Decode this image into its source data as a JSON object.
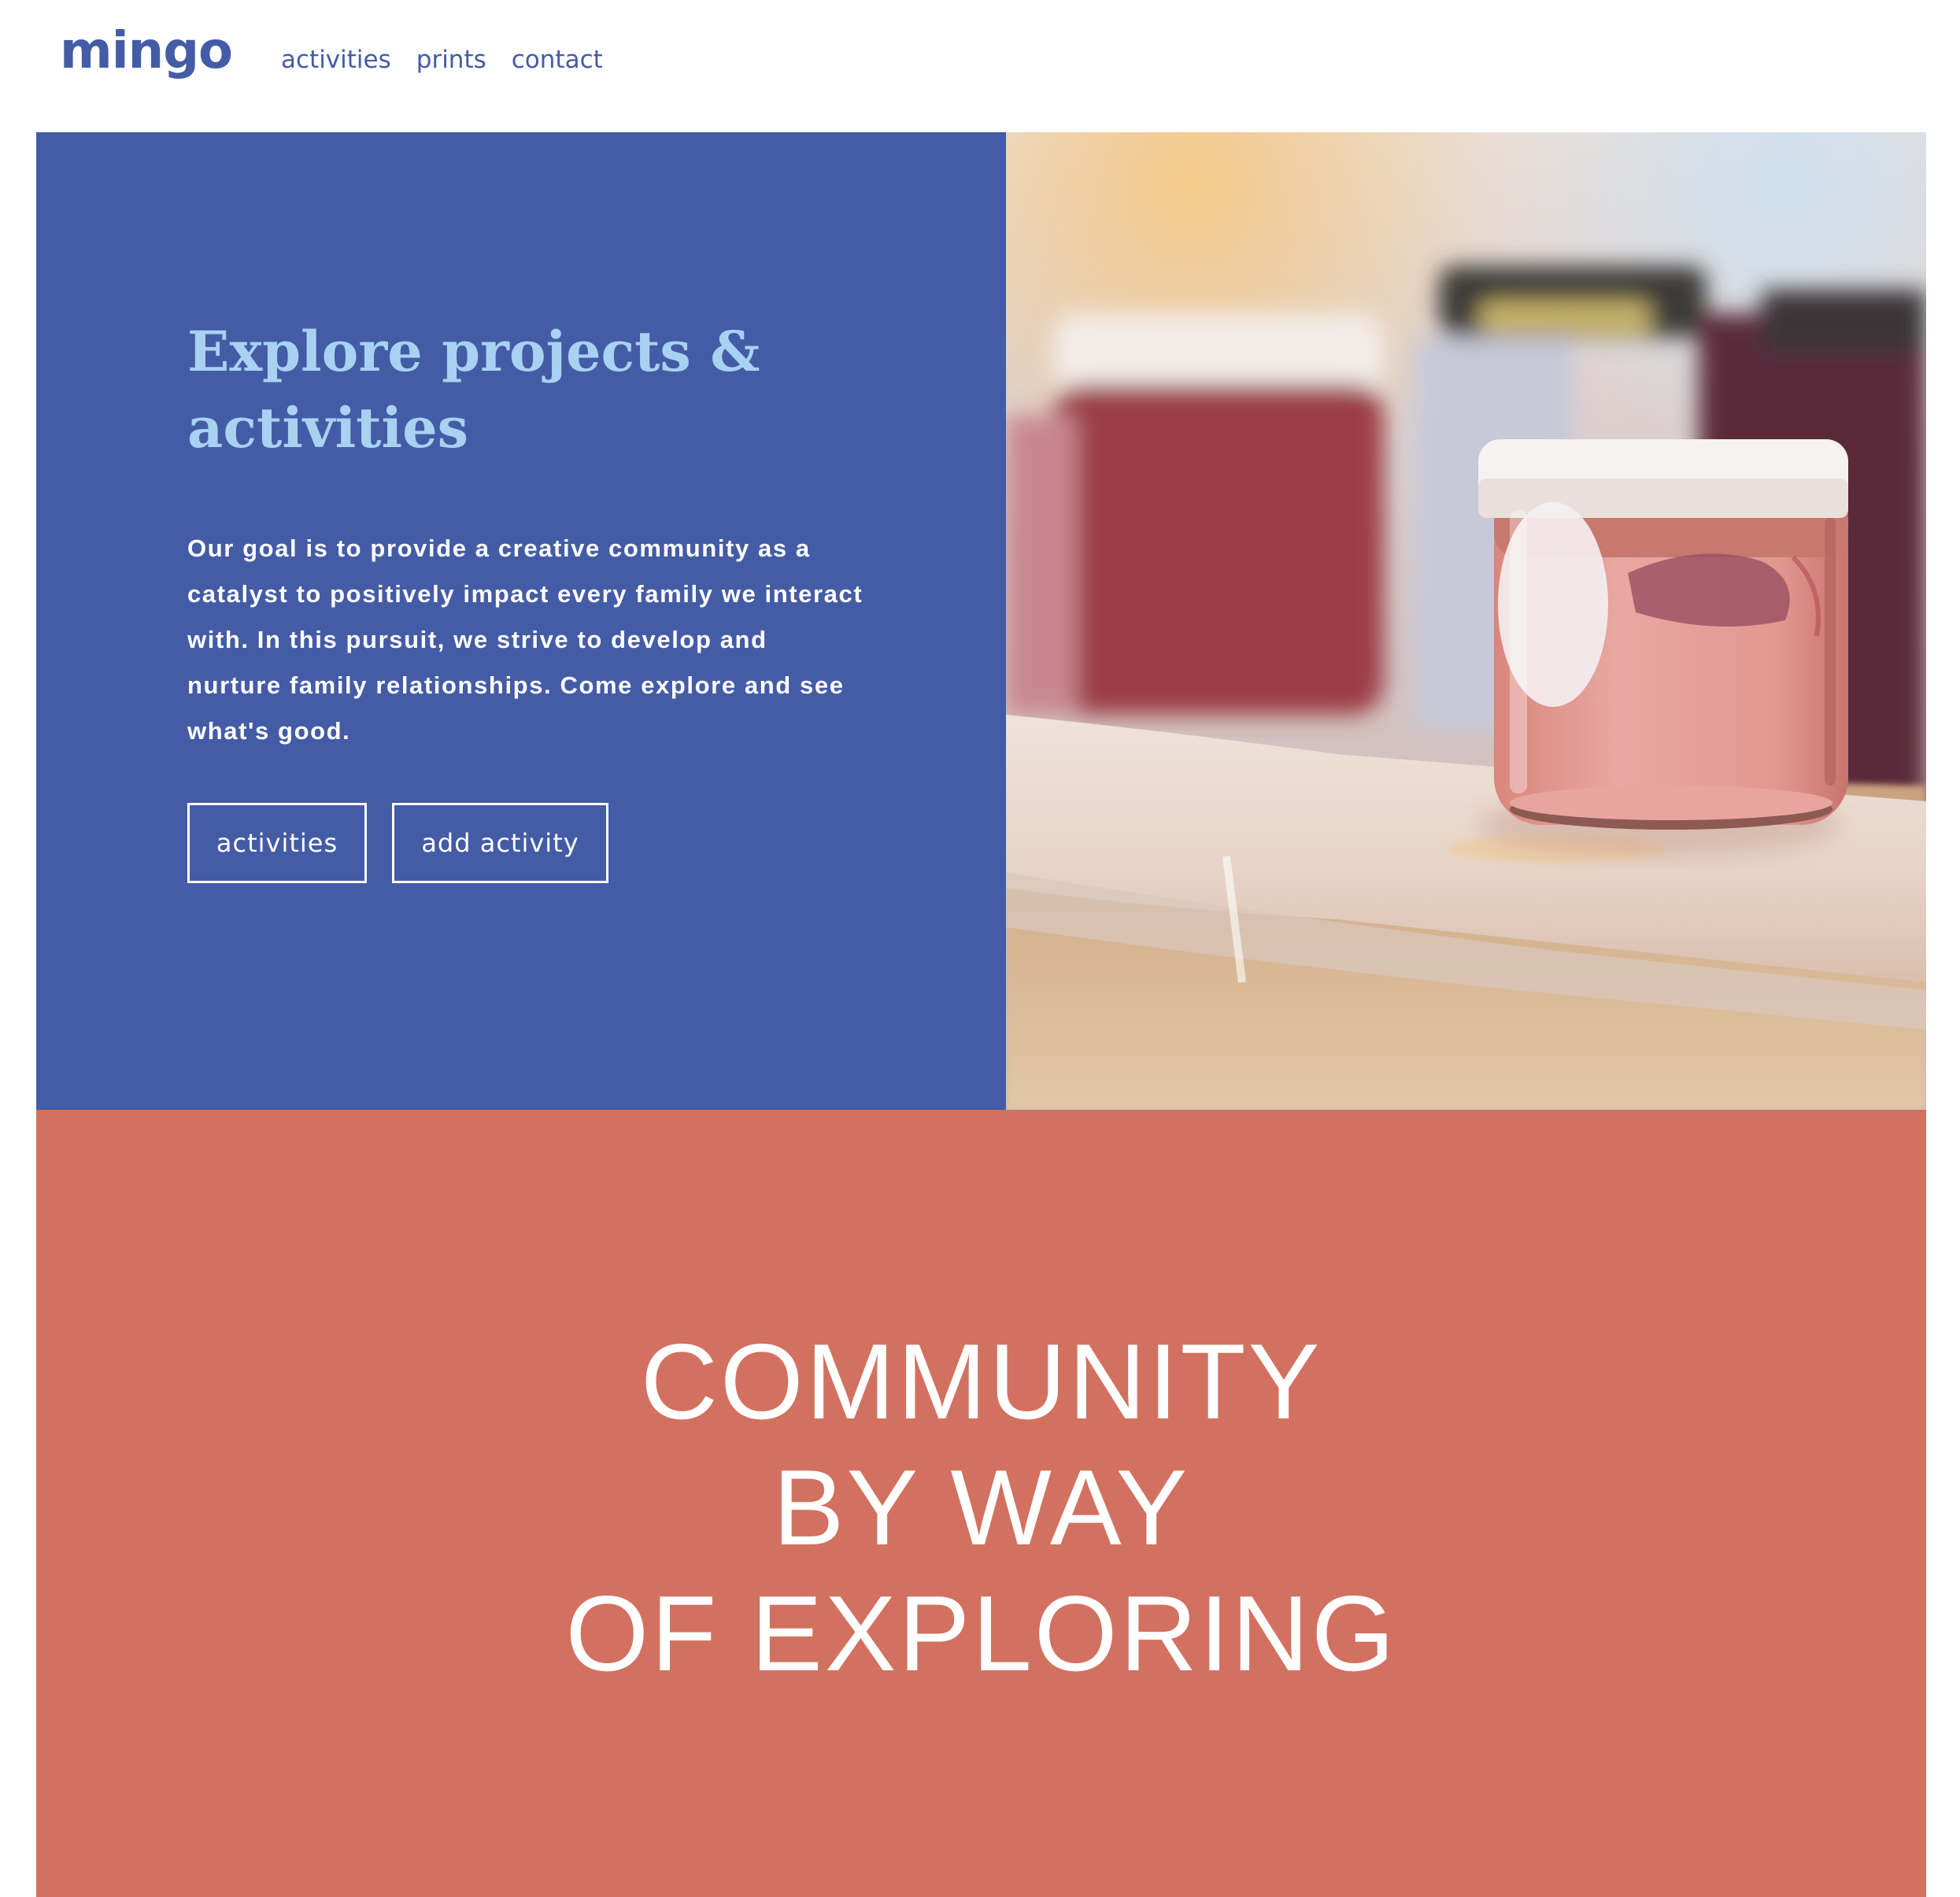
{
  "header": {
    "logo": "mingo",
    "nav": [
      "activities",
      "prints",
      "contact"
    ]
  },
  "hero": {
    "title": "Explore projects & activities",
    "description": "Our goal is to provide a creative community as a catalyst to positively impact every family we interact with. In this pursuit, we strive to develop and nurture family relationships. Come explore and see what's good.",
    "buttons": [
      "activities",
      "add activity"
    ],
    "image": "paint-jars-photo"
  },
  "community": {
    "lines": [
      "COMMUNITY",
      "BY WAY",
      "OF EXPLORING"
    ]
  },
  "colors": {
    "brand_blue": "#445ca6",
    "light_blue": "#a9d1f2",
    "coral": "#d27160",
    "white": "#ffffff"
  }
}
